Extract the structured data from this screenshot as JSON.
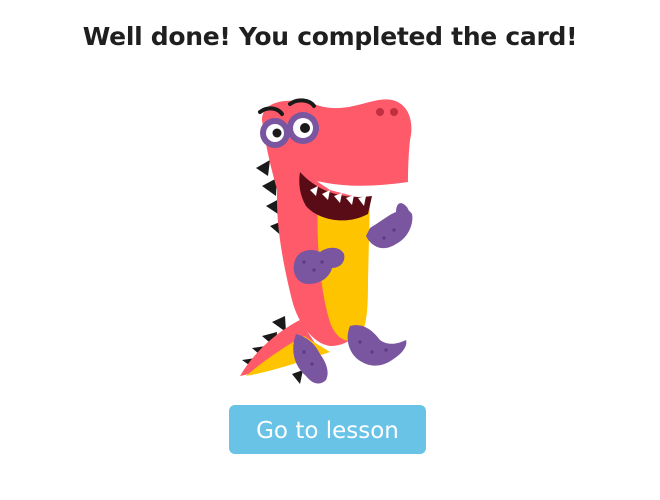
{
  "completion": {
    "title": "Well done! You completed the card!",
    "mascot_icon": "dinosaur-mascot-icon",
    "button_label": "Go to lesson"
  },
  "colors": {
    "button": "#68c3e6",
    "title": "#1f1f1f",
    "dino_body": "#ff5a6a",
    "dino_belly": "#ffc400",
    "dino_limbs": "#7a55a0",
    "dino_spikes": "#1a1a1a"
  }
}
